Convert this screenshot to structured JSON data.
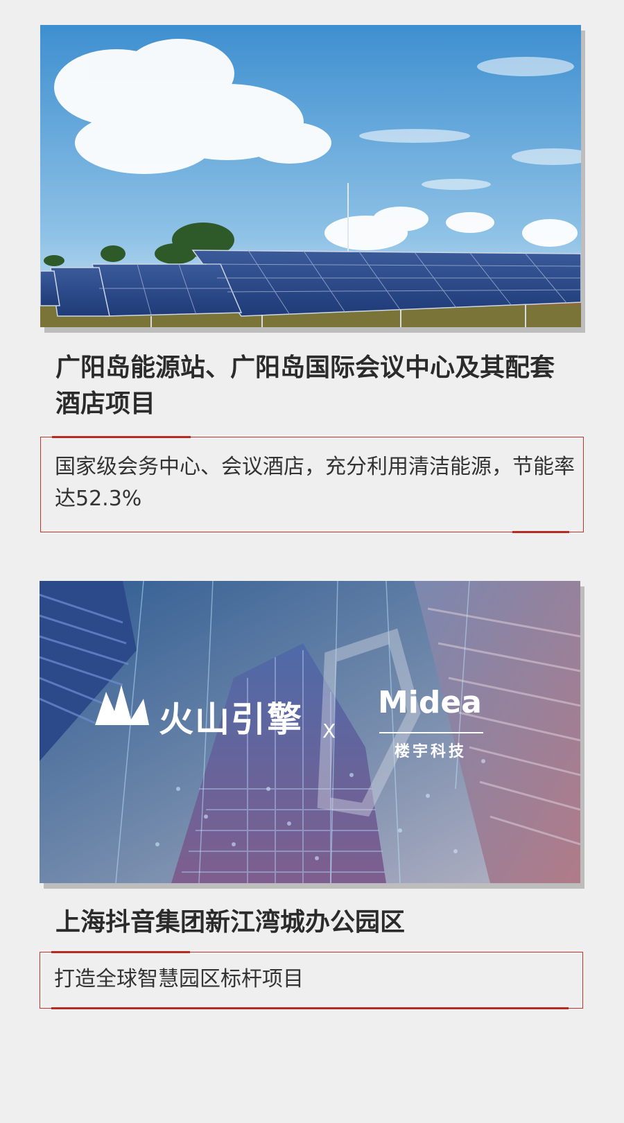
{
  "projects": [
    {
      "title": "广阳岛能源站、广阳岛国际会议中心及其配套酒店项目",
      "description": "国家级会务中心、会议酒店，充分利用清洁能源，节能率达52.3%",
      "image": "solar-panels-photo"
    },
    {
      "title": "上海抖音集团新江湾城办公园区",
      "description": "打造全球智慧园区标杆项目",
      "image": "smart-building-photo",
      "logos": {
        "left": "火山引擎",
        "separator": "X",
        "right_brand": "Midea",
        "right_sub": "楼宇科技"
      }
    }
  ],
  "colors": {
    "accent": "#b52a21",
    "border": "#c2342b",
    "background": "#efefef"
  }
}
